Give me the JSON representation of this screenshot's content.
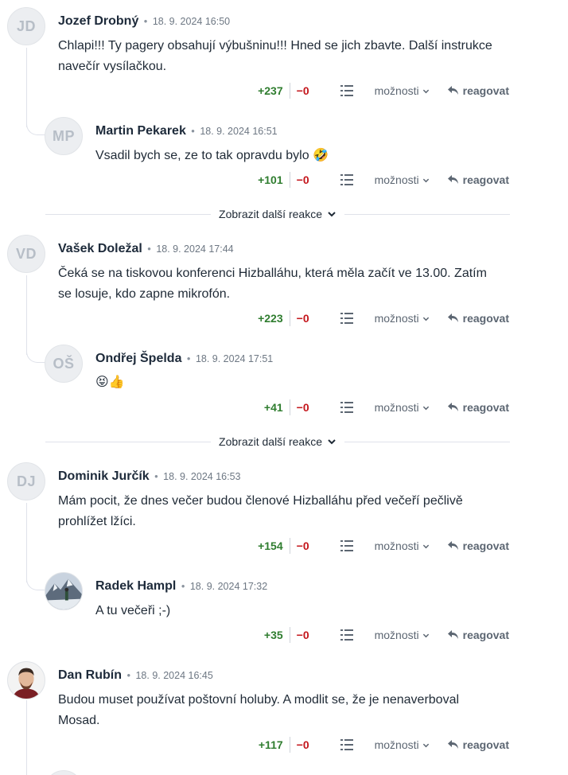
{
  "comments": [
    {
      "initials": "JD",
      "author": "Jozef Drobný",
      "date": "18. 9. 2024 16:50",
      "text": "Chlapi!!! Ty pagery obsahují výbušninu!!! Hned se jich zbavte. Další instrukce navečír vysílačkou.",
      "up": "+237",
      "down": "−0",
      "options": "možnosti",
      "reply": "reagovat"
    },
    {
      "initials": "MP",
      "author": "Martin Pekarek",
      "date": "18. 9. 2024 16:51",
      "text": "Vsadil bych se, ze to tak opravdu bylo 🤣",
      "up": "+101",
      "down": "−0",
      "options": "možnosti",
      "reply": "reagovat"
    },
    {
      "initials": "VD",
      "author": "Vašek Doležal",
      "date": "18. 9. 2024 17:44",
      "text": "Čeká se na tiskovou konferenci Hizballáhu, která měla začít ve 13.00. Zatím se losuje, kdo zapne mikrofón.",
      "up": "+223",
      "down": "−0",
      "options": "možnosti",
      "reply": "reagovat"
    },
    {
      "initials": "OŠ",
      "author": "Ondřej Špelda",
      "date": "18. 9. 2024 17:51",
      "text": "😝👍",
      "up": "+41",
      "down": "−0",
      "options": "možnosti",
      "reply": "reagovat"
    },
    {
      "initials": "DJ",
      "author": "Dominik Jurčík",
      "date": "18. 9. 2024 16:53",
      "text": "Mám pocit, že dnes večer budou členové Hizballáhu před večeří pečlivě prohlížet lžíci.",
      "up": "+154",
      "down": "−0",
      "options": "možnosti",
      "reply": "reagovat"
    },
    {
      "initials": "",
      "author": "Radek Hampl",
      "date": "18. 9. 2024 17:32",
      "text": "A tu večeři ;-)",
      "up": "+35",
      "down": "−0",
      "options": "možnosti",
      "reply": "reagovat"
    },
    {
      "initials": "",
      "author": "Dan Rubín",
      "date": "18. 9. 2024 16:45",
      "text": "Budou muset používat poštovní holuby. A modlit se, že je nenaverboval Mosad.",
      "up": "+117",
      "down": "−0",
      "options": "možnosti",
      "reply": "reagovat"
    }
  ],
  "more_reactions": [
    "Zobrazit další reakce",
    "Zobrazit další reakce"
  ],
  "separator": "•",
  "colors": {
    "upvote": "#2f7d2f",
    "downvote": "#c4161c",
    "thread_line": "#dfe2ea"
  },
  "icons": [
    "list-icon",
    "chevron-down-icon",
    "reply-arrow-icon"
  ]
}
